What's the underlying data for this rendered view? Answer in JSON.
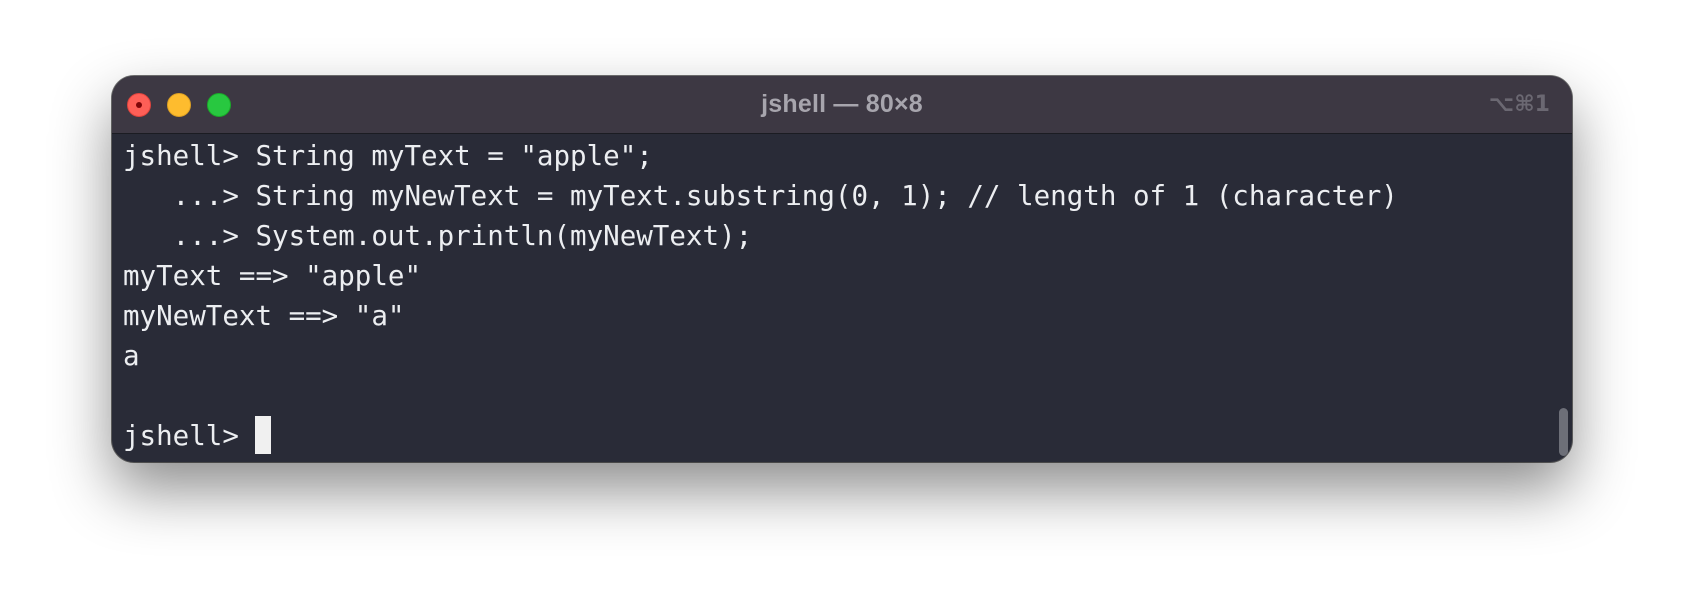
{
  "window": {
    "title": "jshell — 80×8",
    "shortcut": "⌥⌘1"
  },
  "terminal": {
    "lines": [
      "jshell> String myText = \"apple\";",
      "   ...> String myNewText = myText.substring(0, 1); // length of 1 (character)",
      "   ...> System.out.println(myNewText);",
      "myText ==> \"apple\"",
      "myNewText ==> \"a\"",
      "a",
      ""
    ],
    "prompt": "jshell> "
  },
  "colors": {
    "background": "#292b37",
    "titlebar": "#3d3843",
    "text": "#eceef1"
  },
  "icons": {
    "close": "close-traffic-light-icon",
    "minimize": "minimize-traffic-light-icon",
    "zoom": "zoom-traffic-light-icon"
  }
}
